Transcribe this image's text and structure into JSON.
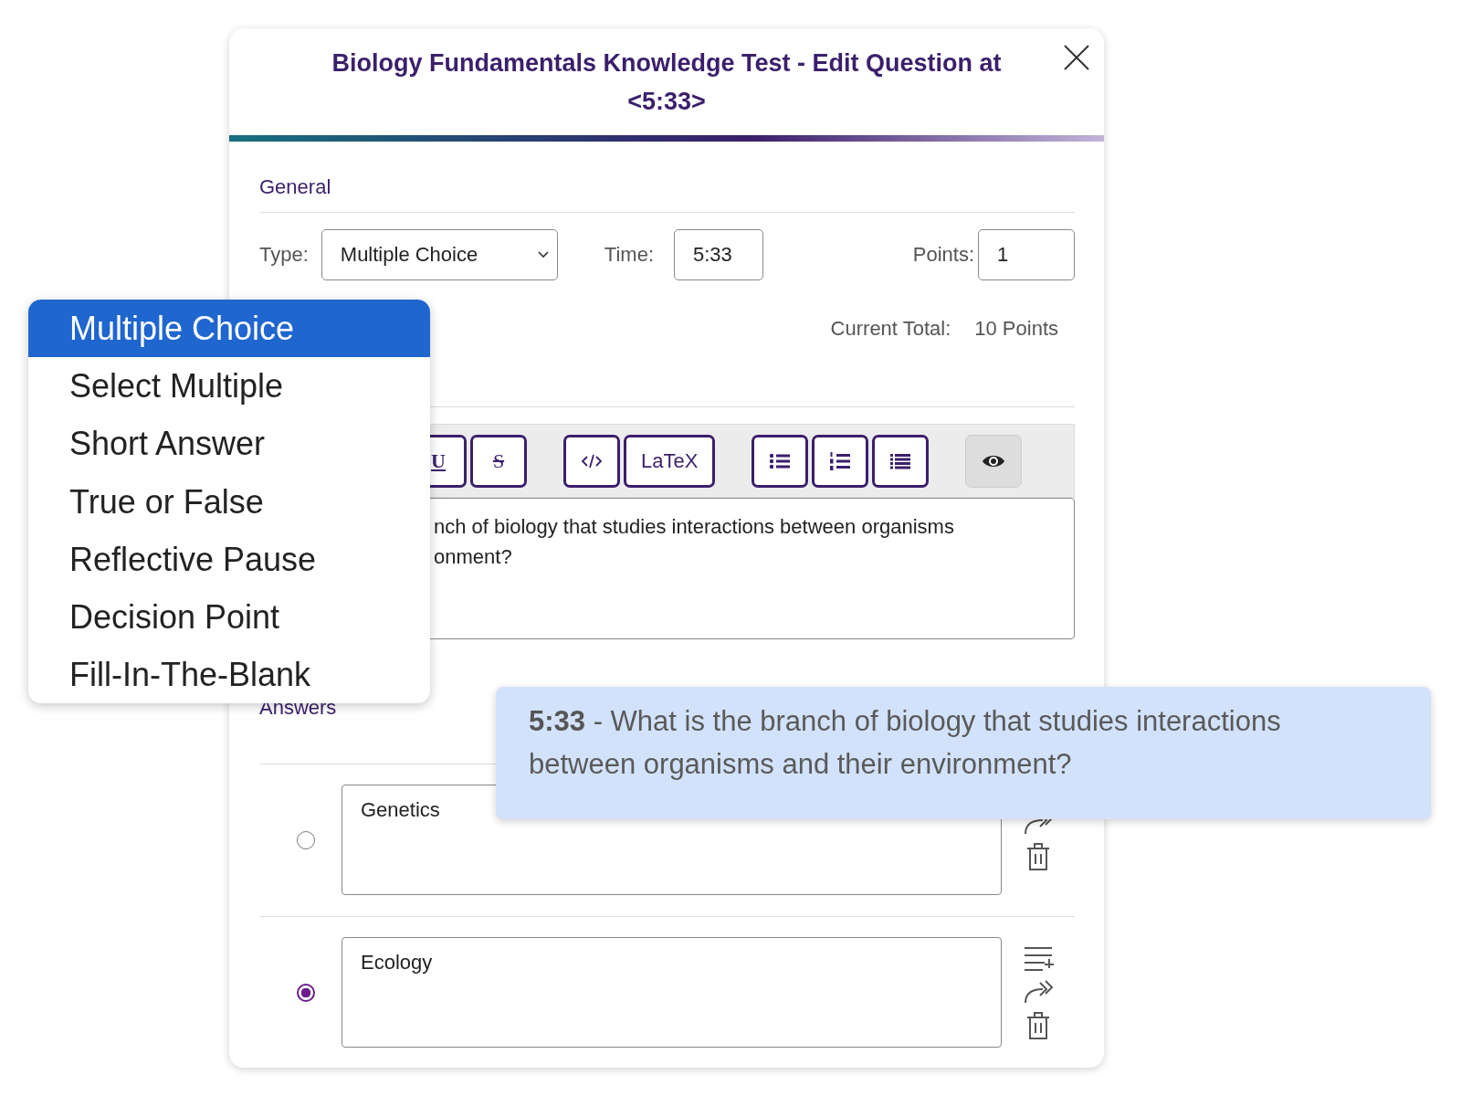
{
  "dialog": {
    "title": "Biology Fundamentals Knowledge Test - Edit Question at <5:33>"
  },
  "general": {
    "heading": "General",
    "type_label": "Type:",
    "type_value": "Multiple Choice",
    "time_label": "Time:",
    "time_value": "5:33",
    "points_label": "Points:",
    "points_value": "1",
    "total_label": "Current Total:",
    "total_value": "10 Points"
  },
  "toolbar": [
    [
      {
        "kind": "underline",
        "label": "U"
      },
      {
        "kind": "strike",
        "label": "S"
      }
    ],
    [
      {
        "kind": "code"
      },
      {
        "kind": "text",
        "label": "LaTeX"
      }
    ],
    [
      {
        "kind": "bullets"
      },
      {
        "kind": "numbers"
      },
      {
        "kind": "list"
      }
    ],
    [
      {
        "kind": "preview"
      }
    ]
  ],
  "question": {
    "lines": [
      "nch of biology that studies interactions between organisms",
      "onment?"
    ]
  },
  "answers": {
    "heading": "Answers",
    "items": [
      {
        "text": "Genetics",
        "selected": false,
        "actions": [
          {
            "kind": "forward"
          },
          {
            "kind": "delete"
          }
        ]
      },
      {
        "text": "Ecology",
        "selected": true,
        "actions": [
          {
            "kind": "add-line"
          },
          {
            "kind": "forward"
          },
          {
            "kind": "delete"
          }
        ]
      }
    ]
  },
  "type_menu": [
    {
      "label": "Multiple Choice",
      "selected": true
    },
    {
      "label": "Select Multiple",
      "selected": false
    },
    {
      "label": "Short Answer",
      "selected": false
    },
    {
      "label": "True or False",
      "selected": false
    },
    {
      "label": "Reflective Pause",
      "selected": false
    },
    {
      "label": "Decision Point",
      "selected": false
    },
    {
      "label": "Fill-In-The-Blank",
      "selected": false
    }
  ],
  "tooltip": {
    "text": "**5:33** - What is the branch of biology that studies interactions between organisms and their environment?"
  }
}
